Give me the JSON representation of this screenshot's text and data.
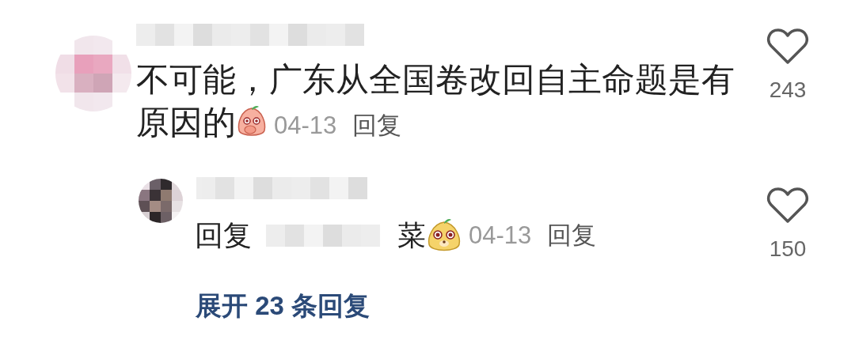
{
  "comment": {
    "text_lines": [
      "不可能，广东从全国卷改回自主命题是有",
      "原因的"
    ],
    "date": "04-13",
    "reply_action": "回复",
    "likes": "243",
    "liked": false
  },
  "reply": {
    "prefix": "回复",
    "text": "菜",
    "date": "04-13",
    "reply_action": "回复",
    "likes": "150",
    "liked": false
  },
  "expand_link": "展开 23 条回复"
}
